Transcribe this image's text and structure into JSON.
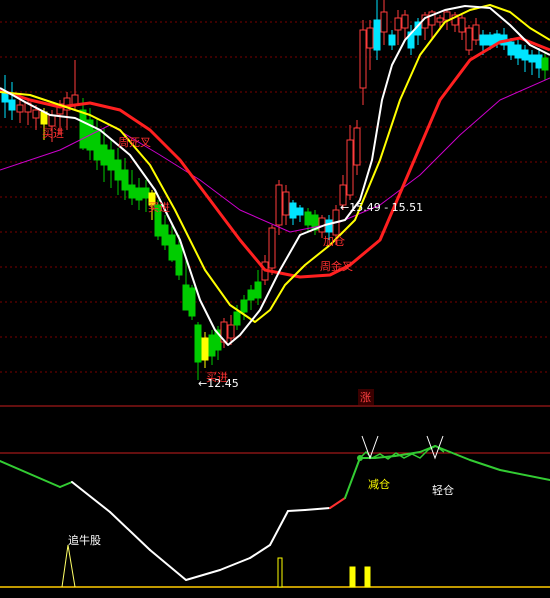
{
  "colors": {
    "background": "#000000",
    "grid": "#7a0000",
    "separator": "#c81e1e",
    "up_candle": "#ff3c3c",
    "down_candle": "#00cc00",
    "cyan_candle": "#00e5ff",
    "yellow_candle": "#ffff00",
    "ma_white": "#ffffff",
    "ma_yellow": "#ffff00",
    "ma_red": "#ff2020",
    "ma_magenta": "#cc00cc",
    "osc_white": "#ffffff",
    "osc_green": "#33cc33",
    "osc_red": "#ff3030",
    "signal_bar": "#ffff00",
    "label_red": "#ff3030",
    "label_white": "#ffffff"
  },
  "chart_data": {
    "type": "candlestick",
    "price_annotations": {
      "low": {
        "value": "12.45",
        "text": "←12.45"
      },
      "mid": {
        "value": "15.49-15.51",
        "text": "←15.49 - 15.51"
      }
    },
    "signals": {
      "buy_1": "买进",
      "buy_2": "买进",
      "buy_3": "买进",
      "weekly_death_cross": "周死叉",
      "weekly_golden_cross": "周金叉",
      "add_position": "加仓"
    },
    "indicator_panel": {
      "badge": "涨",
      "labels": {
        "chase_bull": "追牛股",
        "reduce": "减仓",
        "light": "轻仓"
      },
      "oscillator": [
        [
          0,
          461,
          "g"
        ],
        [
          60,
          487,
          "g"
        ],
        [
          72,
          482,
          "g"
        ],
        [
          110,
          512,
          "w"
        ],
        [
          150,
          550,
          "w"
        ],
        [
          186,
          580,
          "w"
        ],
        [
          220,
          570,
          "w"
        ],
        [
          250,
          558,
          "w"
        ],
        [
          270,
          545,
          "w"
        ],
        [
          288,
          511,
          "w"
        ],
        [
          305,
          510,
          "w"
        ],
        [
          330,
          508,
          "w"
        ],
        [
          345,
          498,
          "r"
        ],
        [
          360,
          458,
          "g"
        ],
        [
          375,
          458,
          "g"
        ],
        [
          395,
          456,
          "g"
        ],
        [
          420,
          452,
          "g"
        ],
        [
          435,
          446,
          "g"
        ],
        [
          470,
          460,
          "g"
        ],
        [
          500,
          470,
          "g"
        ],
        [
          550,
          480,
          "g"
        ]
      ],
      "triangles": [
        [
          62,
          68,
          75,
          587
        ],
        [
          362,
          370,
          378,
          458
        ],
        [
          427,
          435,
          443,
          458
        ]
      ],
      "signal_bars": [
        [
          278,
          558,
          282,
          587
        ],
        [
          350,
          567,
          355,
          587
        ],
        [
          365,
          567,
          370,
          587
        ]
      ]
    }
  }
}
